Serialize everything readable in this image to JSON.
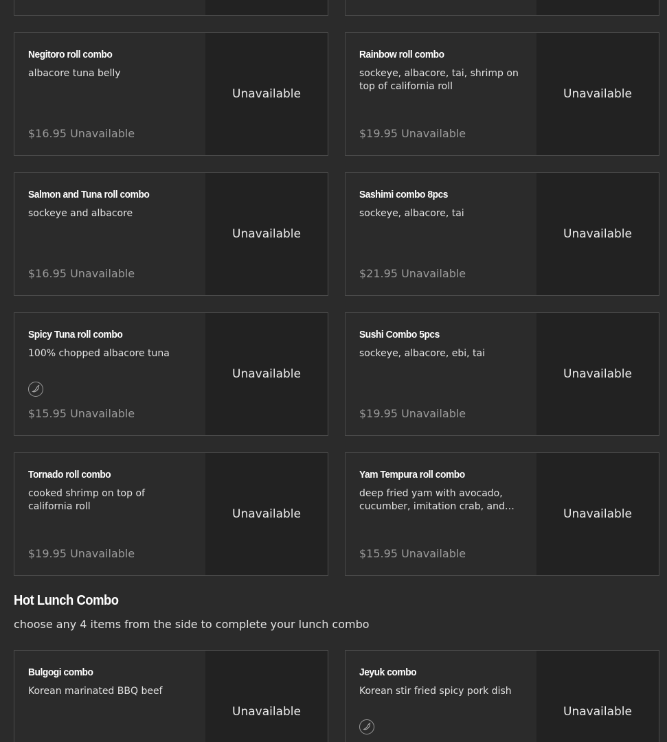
{
  "top_row": {
    "partial": true
  },
  "sushi_combos": [
    {
      "name": "Negitoro roll combo",
      "description": "albacore tuna belly",
      "price": "$16.95",
      "status": "Unavailable",
      "media_status": "Unavailable",
      "spicy": false
    },
    {
      "name": "Rainbow roll combo",
      "description": "sockeye, albacore, tai, shrimp on top of california roll",
      "price": "$19.95",
      "status": "Unavailable",
      "media_status": "Unavailable",
      "spicy": false
    },
    {
      "name": "Salmon and Tuna roll combo",
      "description": "sockeye and albacore",
      "price": "$16.95",
      "status": "Unavailable",
      "media_status": "Unavailable",
      "spicy": false
    },
    {
      "name": "Sashimi combo 8pcs",
      "description": "sockeye, albacore, tai",
      "price": "$21.95",
      "status": "Unavailable",
      "media_status": "Unavailable",
      "spicy": false
    },
    {
      "name": "Spicy Tuna roll combo",
      "description": "100% chopped albacore tuna",
      "price": "$15.95",
      "status": "Unavailable",
      "media_status": "Unavailable",
      "spicy": true
    },
    {
      "name": "Sushi Combo 5pcs",
      "description": "sockeye, albacore, ebi, tai",
      "price": "$19.95",
      "status": "Unavailable",
      "media_status": "Unavailable",
      "spicy": false
    },
    {
      "name": "Tornado roll combo",
      "description": "cooked shrimp on top of california roll",
      "price": "$19.95",
      "status": "Unavailable",
      "media_status": "Unavailable",
      "spicy": false
    },
    {
      "name": "Yam Tempura roll combo",
      "description": "deep fried yam with avocado, cucumber, imitation crab, and BBQ eel",
      "price": "$15.95",
      "status": "Unavailable",
      "media_status": "Unavailable",
      "spicy": false
    }
  ],
  "hot_lunch": {
    "title": "Hot Lunch Combo",
    "subtitle": "choose any 4 items from the side to complete your lunch combo",
    "items": [
      {
        "name": "Bulgogi combo",
        "description": "Korean marinated BBQ beef",
        "media_status": "Unavailable",
        "spicy": false
      },
      {
        "name": "Jeyuk combo",
        "description": "Korean stir fried spicy pork dish",
        "media_status": "Unavailable",
        "spicy": true
      }
    ]
  },
  "icons": {
    "spicy": "chili-pepper-icon"
  },
  "colors": {
    "background": "#2b2b2b",
    "media_panel": "#222222",
    "border": "#4a4a4a",
    "muted_text": "#9a9a9a"
  }
}
